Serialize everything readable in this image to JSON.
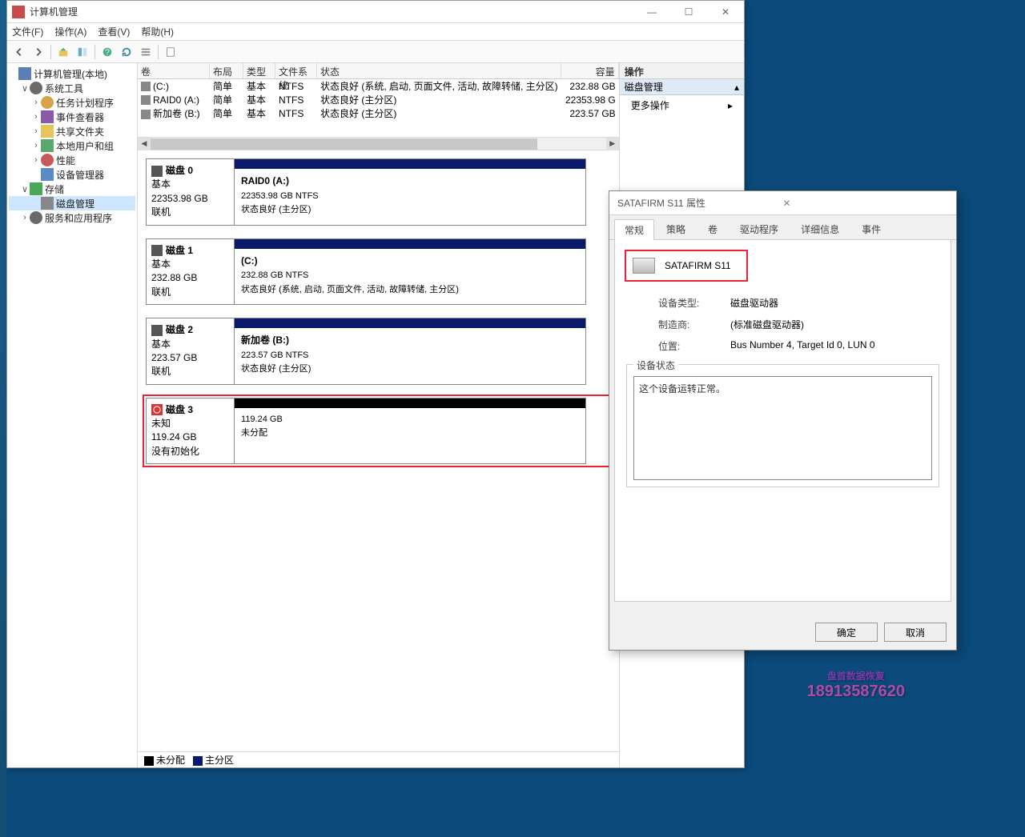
{
  "window": {
    "title": "计算机管理",
    "controls": {
      "min": "—",
      "max": "☐",
      "close": "✕"
    }
  },
  "menu": {
    "file": "文件(F)",
    "action": "操作(A)",
    "view": "查看(V)",
    "help": "帮助(H)"
  },
  "tree": {
    "root": "计算机管理(本地)",
    "systools": "系统工具",
    "schedule": "任务计划程序",
    "eventviewer": "事件查看器",
    "shares": "共享文件夹",
    "users": "本地用户和组",
    "perf": "性能",
    "devmgr": "设备管理器",
    "storage": "存储",
    "diskmgmt": "磁盘管理",
    "services": "服务和应用程序"
  },
  "vol_header": {
    "vol": "卷",
    "layout": "布局",
    "type": "类型",
    "fs": "文件系统",
    "status": "状态",
    "capacity": "容量"
  },
  "volumes": [
    {
      "name": "(C:)",
      "layout": "简单",
      "type": "基本",
      "fs": "NTFS",
      "status": "状态良好 (系统, 启动, 页面文件, 活动, 故障转储, 主分区)",
      "cap": "232.88 GB"
    },
    {
      "name": "RAID0 (A:)",
      "layout": "简单",
      "type": "基本",
      "fs": "NTFS",
      "status": "状态良好 (主分区)",
      "cap": "22353.98 G"
    },
    {
      "name": "新加卷 (B:)",
      "layout": "简单",
      "type": "基本",
      "fs": "NTFS",
      "status": "状态良好 (主分区)",
      "cap": "223.57 GB"
    }
  ],
  "disks": [
    {
      "label": "磁盘 0",
      "kind": "基本",
      "size": "22353.98 GB",
      "state": "联机",
      "part": {
        "title": "RAID0  (A:)",
        "line2": "22353.98 GB NTFS",
        "line3": "状态良好 (主分区)",
        "band": "blue"
      }
    },
    {
      "label": "磁盘 1",
      "kind": "基本",
      "size": "232.88 GB",
      "state": "联机",
      "part": {
        "title": "(C:)",
        "line2": "232.88 GB NTFS",
        "line3": "状态良好 (系统, 启动, 页面文件, 活动, 故障转储, 主分区)",
        "band": "blue"
      }
    },
    {
      "label": "磁盘 2",
      "kind": "基本",
      "size": "223.57 GB",
      "state": "联机",
      "part": {
        "title": "新加卷  (B:)",
        "line2": "223.57 GB NTFS",
        "line3": "状态良好 (主分区)",
        "band": "blue"
      }
    },
    {
      "label": "磁盘 3",
      "kind": "未知",
      "size": "119.24 GB",
      "state": "没有初始化",
      "part": {
        "title": "",
        "line2": "119.24 GB",
        "line3": "未分配",
        "band": "black"
      },
      "highlight": true,
      "err": true
    }
  ],
  "legend": {
    "unalloc": "未分配",
    "primary": "主分区"
  },
  "actions": {
    "header": "操作",
    "section": "磁盘管理",
    "more": "更多操作"
  },
  "prop": {
    "title": "SATAFIRM   S11 属性",
    "close": "✕",
    "tabs": {
      "general": "常规",
      "policy": "策略",
      "vol": "卷",
      "driver": "驱动程序",
      "detail": "详细信息",
      "event": "事件"
    },
    "devname": "SATAFIRM   S11",
    "devtype_lbl": "设备类型:",
    "devtype_val": "磁盘驱动器",
    "mfr_lbl": "制造商:",
    "mfr_val": "(标准磁盘驱动器)",
    "loc_lbl": "位置:",
    "loc_val": "Bus Number 4, Target Id 0, LUN 0",
    "status_legend": "设备状态",
    "status_text": "这个设备运转正常。",
    "ok": "确定",
    "cancel": "取消"
  },
  "watermark": {
    "line1": "盘首数据恢复",
    "phone": "18913587620"
  }
}
